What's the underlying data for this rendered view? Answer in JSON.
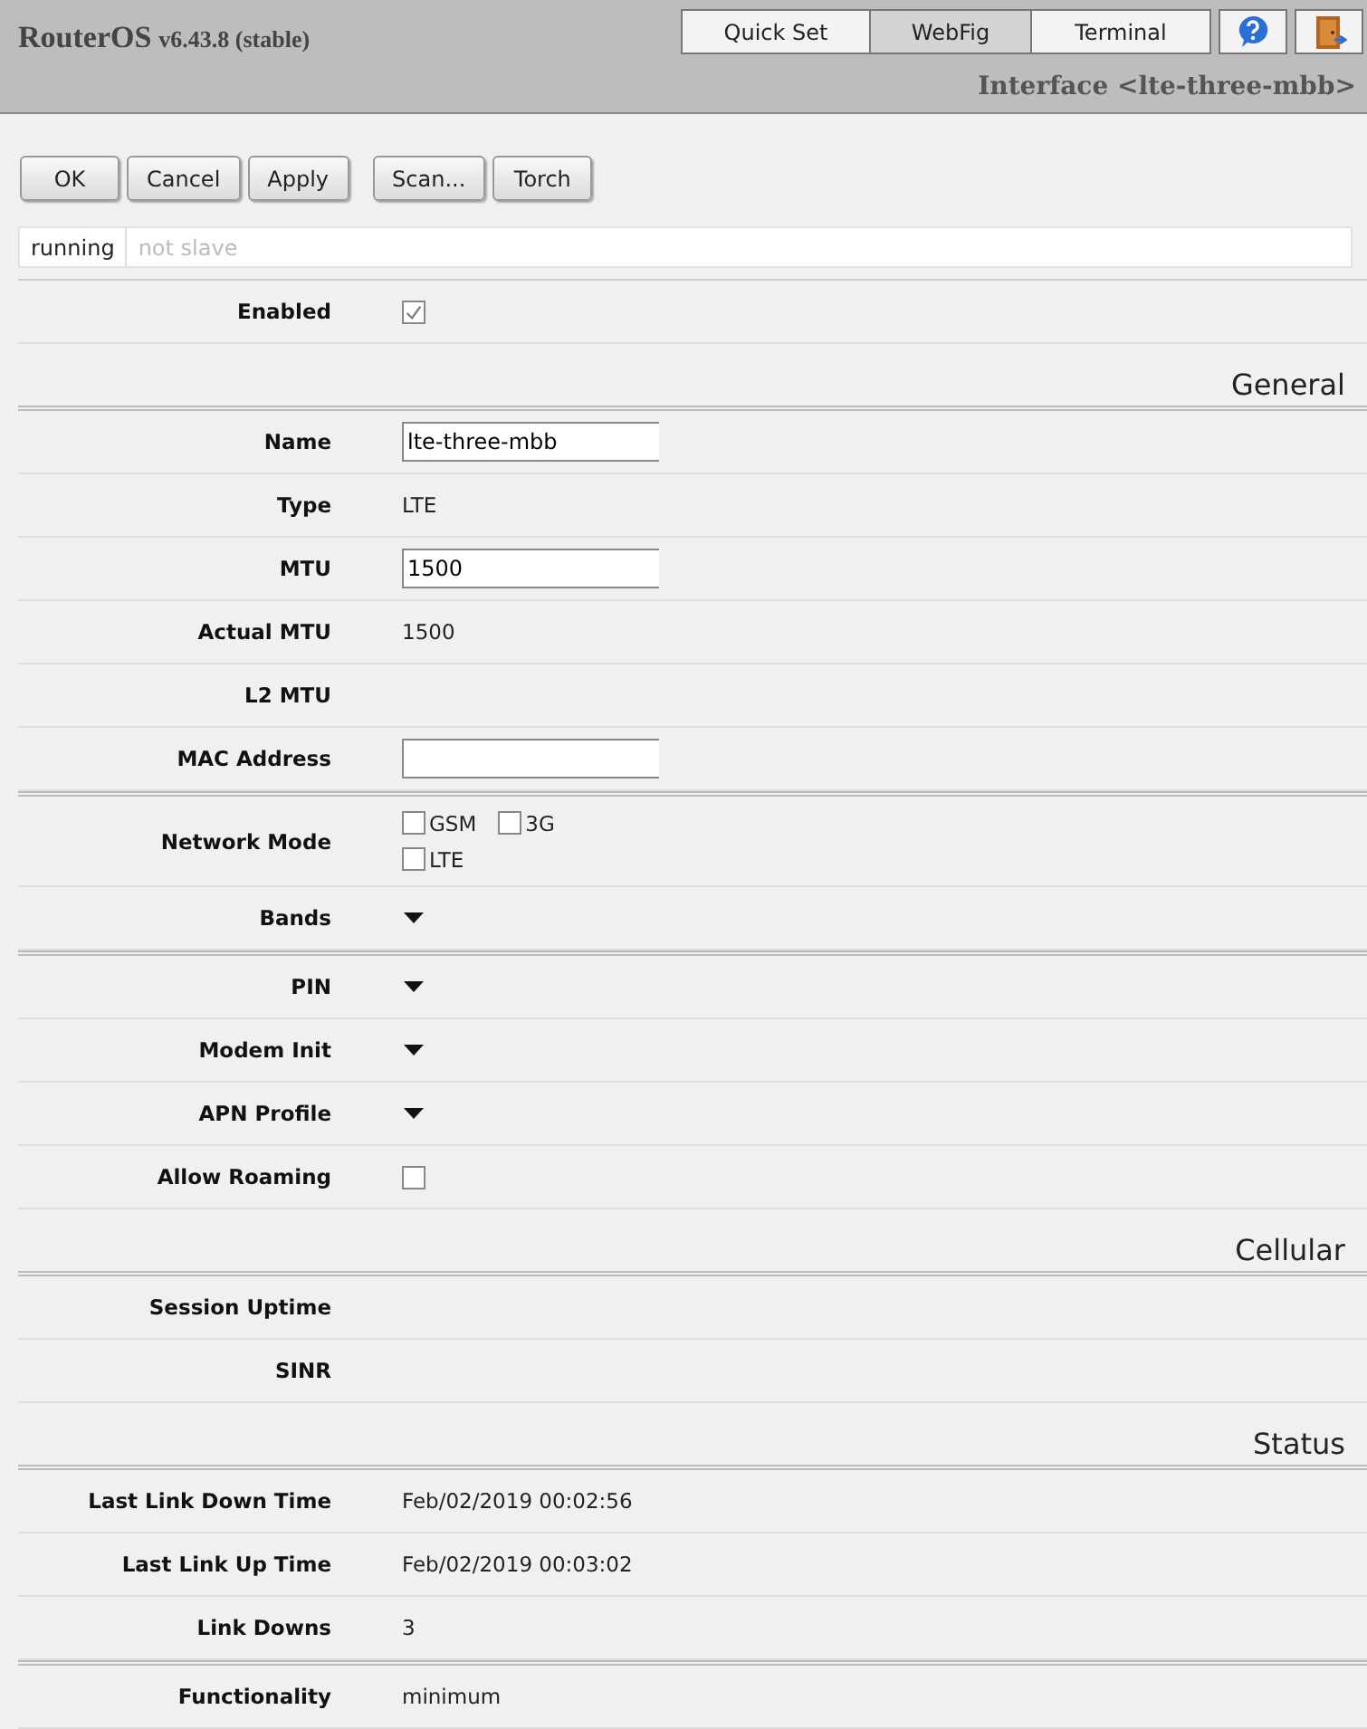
{
  "header": {
    "product": "RouterOS",
    "version": "v6.43.8 (stable)",
    "modes": [
      {
        "label": "Quick Set",
        "selected": false
      },
      {
        "label": "WebFig",
        "selected": true
      },
      {
        "label": "Terminal",
        "selected": false
      }
    ],
    "page_title": "Interface <lte-three-mbb>"
  },
  "actions": [
    [
      "OK",
      "Cancel",
      "Apply"
    ],
    [
      "Scan...",
      "Torch"
    ]
  ],
  "status_flags": [
    {
      "label": "running",
      "active": true
    },
    {
      "label": "not slave",
      "active": false
    }
  ],
  "groups": [
    {
      "rows": [
        {
          "kind": "checkbox",
          "label": "Enabled",
          "checked": true
        }
      ]
    },
    {
      "heading": "General",
      "rows": [
        {
          "kind": "field",
          "label": "Name",
          "value": "lte-three-mbb"
        },
        {
          "kind": "text",
          "label": "Type",
          "value": "LTE"
        },
        {
          "kind": "field",
          "label": "MTU",
          "value": "1500"
        },
        {
          "kind": "text",
          "label": "Actual MTU",
          "value": "1500"
        },
        {
          "kind": "text",
          "label": "L2 MTU"
        },
        {
          "kind": "field",
          "label": "MAC Address"
        }
      ]
    },
    {
      "rows": [
        {
          "kind": "options",
          "label": "Network Mode",
          "options": [
            {
              "label": "GSM",
              "checked": false
            },
            {
              "label": "3G",
              "checked": false
            },
            {
              "label": "LTE",
              "checked": false
            }
          ]
        },
        {
          "kind": "dropdown",
          "label": "Bands",
          "expanded": false
        }
      ]
    },
    {
      "rows": [
        {
          "kind": "dropdown",
          "label": "PIN",
          "expanded": false
        },
        {
          "kind": "dropdown",
          "label": "Modem Init",
          "expanded": false
        },
        {
          "kind": "dropdown",
          "label": "APN Profile",
          "expanded": false
        },
        {
          "kind": "checkbox",
          "label": "Allow Roaming",
          "checked": false
        }
      ]
    },
    {
      "heading": "Cellular",
      "rows": [
        {
          "kind": "text",
          "label": "Session Uptime"
        },
        {
          "kind": "text",
          "label": "SINR"
        }
      ]
    },
    {
      "heading": "Status",
      "rows": [
        {
          "kind": "text",
          "label": "Last Link Down Time",
          "value": "Feb/02/2019 00:02:56"
        },
        {
          "kind": "text",
          "label": "Last Link Up Time",
          "value": "Feb/02/2019 00:03:02"
        },
        {
          "kind": "text",
          "label": "Link Downs",
          "value": "3"
        }
      ]
    },
    {
      "rows": [
        {
          "kind": "text",
          "label": "Functionality",
          "value": "minimum"
        }
      ]
    }
  ]
}
